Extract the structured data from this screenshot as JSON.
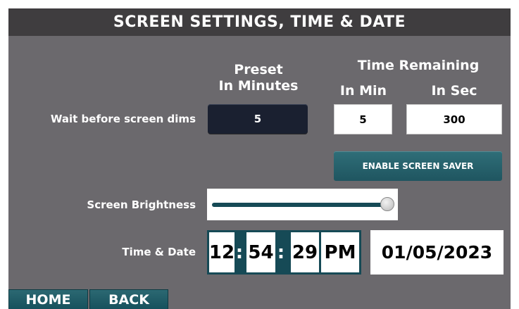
{
  "title": "SCREEN SETTINGS, TIME & DATE",
  "headers": {
    "preset": "Preset",
    "preset_sub": "In Minutes",
    "time_remaining": "Time Remaining",
    "in_min": "In Min",
    "in_sec": "In Sec"
  },
  "rows": {
    "wait_label": "Wait before screen dims",
    "brightness_label": "Screen Brightness",
    "time_date_label": "Time & Date"
  },
  "values": {
    "preset_minutes": "5",
    "remaining_min": "5",
    "remaining_sec": "300"
  },
  "buttons": {
    "screen_saver": "ENABLE SCREEN SAVER",
    "home": "HOME",
    "back": "BACK"
  },
  "brightness_level_percent": 100,
  "clock": {
    "hours": "12",
    "minutes": "54",
    "seconds": "29",
    "separator": ":",
    "ampm": "PM"
  },
  "date": "01/05/2023",
  "colors": {
    "background": "#6b696d",
    "titlebar": "#3f3d3f",
    "teal": "#164a56",
    "dark_button": "#1a2030"
  }
}
